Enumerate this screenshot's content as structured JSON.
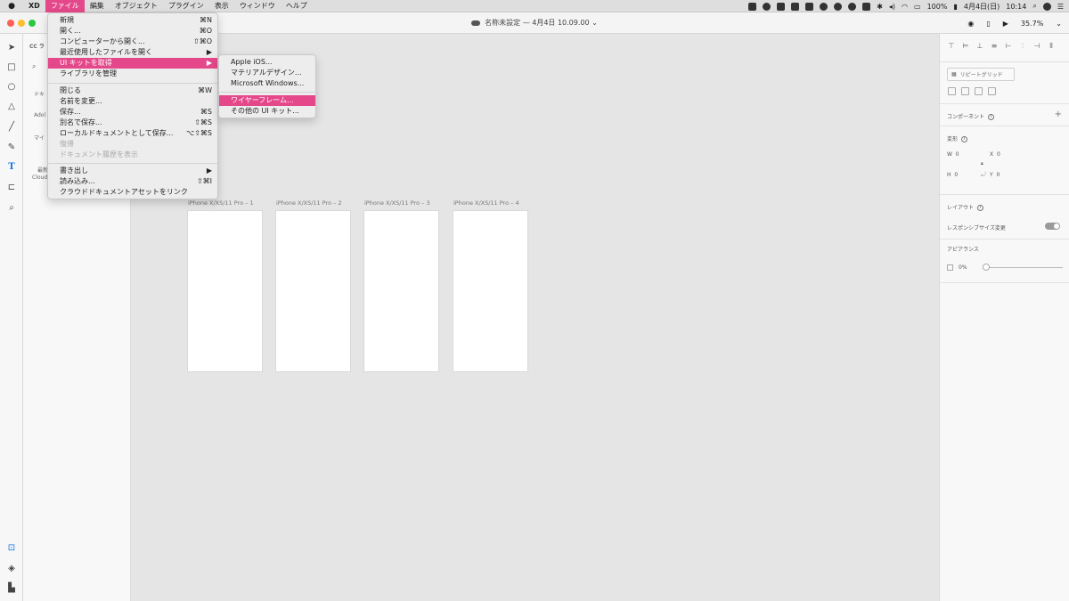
{
  "menubar": {
    "app": "XD",
    "items": [
      "ファイル",
      "編集",
      "オブジェクト",
      "プラグイン",
      "表示",
      "ウィンドウ",
      "ヘルプ"
    ],
    "battery": "100%",
    "date": "4月4日(日)",
    "time": "10:14"
  },
  "titlebar": {
    "document_title": "名称未設定 — 4月4日 10.09.00",
    "zoom": "35.7%"
  },
  "file_menu": {
    "new": "新規",
    "new_sc": "⌘N",
    "open": "開く...",
    "open_sc": "⌘O",
    "open_from_computer": "コンピューターから開く...",
    "open_from_computer_sc": "⇧⌘O",
    "recent": "最近使用したファイルを開く",
    "get_ui_kits": "UI キットを取得",
    "manage_libraries": "ライブラリを管理",
    "close": "閉じる",
    "close_sc": "⌘W",
    "rename": "名前を変更...",
    "save": "保存...",
    "save_sc": "⌘S",
    "save_as": "別名で保存...",
    "save_as_sc": "⇧⌘S",
    "save_local": "ローカルドキュメントとして保存...",
    "save_local_sc": "⌥⇧⌘S",
    "revert": "復帰",
    "show_history": "ドキュメント履歴を表示",
    "export": "書き出し",
    "import": "読み込み...",
    "import_sc": "⇧⌘I",
    "link_assets": "クラウドドキュメントアセットをリンク",
    "arrow": "▶"
  },
  "ui_kit_submenu": {
    "apple_ios": "Apple iOS...",
    "material": "マテリアルデザイン...",
    "windows": "Microsoft Windows...",
    "wireframe": "ワイヤーフレーム...",
    "other": "その他の UI キット..."
  },
  "assets_panel": {
    "header": "CC ラ",
    "doc": "ドキ",
    "adobe": "Adol",
    "my": "マイ",
    "recent": "最新",
    "cloud": "Cloud"
  },
  "artboards": [
    {
      "label": "iPhone X/XS/11 Pro – 1"
    },
    {
      "label": "iPhone X/XS/11 Pro – 2"
    },
    {
      "label": "iPhone X/XS/11 Pro – 3"
    },
    {
      "label": "iPhone X/XS/11 Pro – 4"
    }
  ],
  "properties": {
    "repeat_grid": "リピートグリッド",
    "component": "コンポーネント",
    "transform": "変形",
    "w_label": "W",
    "w_value": "0",
    "h_label": "H",
    "h_value": "0",
    "x_label": "X",
    "x_value": "0",
    "y_label": "Y",
    "y_value": "0",
    "layout": "レイアウト",
    "responsive_resize": "レスポンシブサイズ変更",
    "appearance": "アピアランス",
    "opacity": "0%"
  },
  "colors": {
    "accent": "#e5488a",
    "canvas": "#e5e5e5",
    "close": "#ff5f57",
    "minimize": "#febc2e",
    "maximize": "#28c840"
  }
}
